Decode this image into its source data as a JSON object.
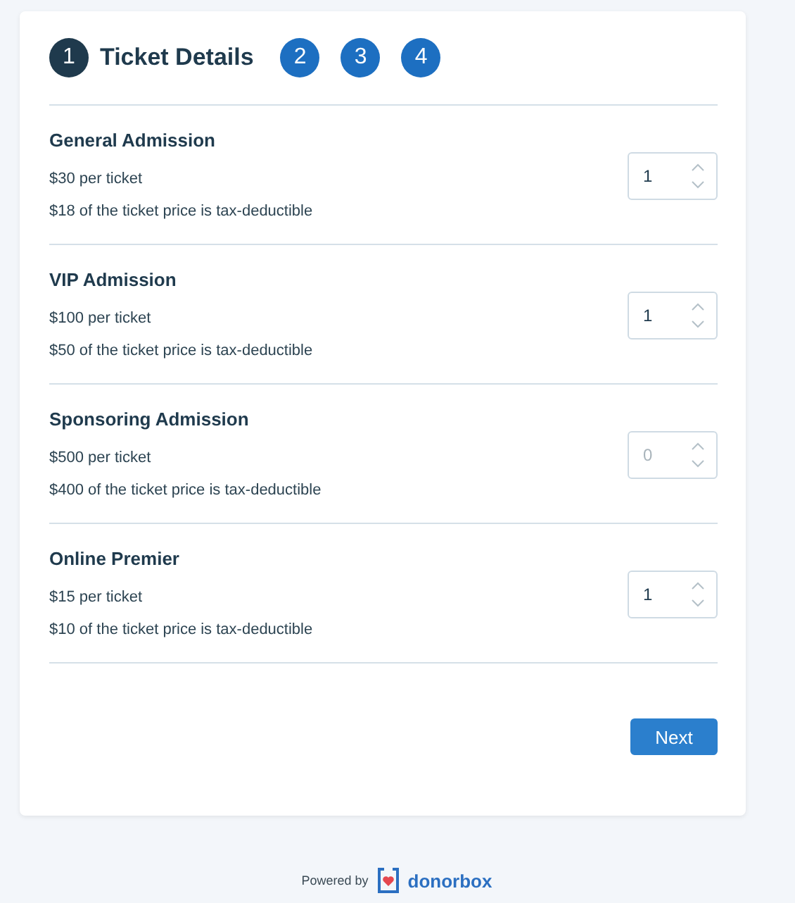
{
  "steps": [
    {
      "number": "1",
      "label": "Ticket Details",
      "selected": true
    },
    {
      "number": "2",
      "selected": false
    },
    {
      "number": "3",
      "selected": false
    },
    {
      "number": "4",
      "selected": false
    }
  ],
  "tickets": [
    {
      "name": "General Admission",
      "price": "$30 per ticket",
      "deductible": "$18 of the ticket price is tax-deductible",
      "quantity": "1",
      "disabled": false
    },
    {
      "name": "VIP Admission",
      "price": "$100 per ticket",
      "deductible": "$50 of the ticket price is tax-deductible",
      "quantity": "1",
      "disabled": false
    },
    {
      "name": "Sponsoring Admission",
      "price": "$500 per ticket",
      "deductible": "$400 of the ticket price is tax-deductible",
      "quantity": "0",
      "disabled": true
    },
    {
      "name": "Online Premier",
      "price": "$15 per ticket",
      "deductible": "$10 of the ticket price is tax-deductible",
      "quantity": "1",
      "disabled": false
    }
  ],
  "next_button": "Next",
  "footer": {
    "powered_by": "Powered by",
    "brand": "donorbox"
  }
}
